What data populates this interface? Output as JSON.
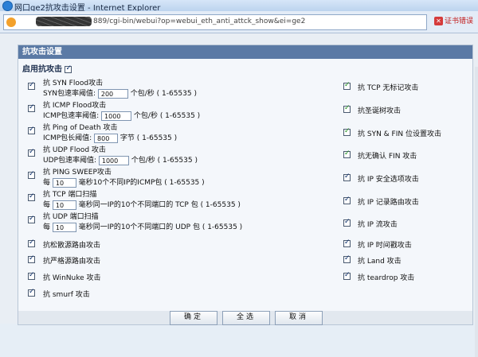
{
  "window": {
    "title": "网口ge2抗攻击设置 - Internet Explorer"
  },
  "address": {
    "url": "http://192.168.1.1:8889/cgi-bin/webui?op=webui_eth_anti_attck_show&ei=ge2",
    "url_shown": "889/cgi-bin/webui?op=webui_eth_anti_attck_show&ei=ge2",
    "cert_error": "证书错误"
  },
  "panel": {
    "title": "抗攻击设置",
    "enable_label": "启用抗攻击"
  },
  "left": [
    {
      "label": "抗 SYN Flood攻击",
      "sub_prefix": "SYN包速率阈值:",
      "value": "200",
      "sub_suffix": "个包/秒 ( 1-65535 )"
    },
    {
      "label": "抗 ICMP Flood攻击",
      "sub_prefix": "ICMP包速率阈值:",
      "value": "1000",
      "sub_suffix": "个包/秒 ( 1-65535 )"
    },
    {
      "label": "抗 Ping of Death 攻击",
      "sub_prefix": "ICMP包长阈值:",
      "value": "800",
      "sub_suffix": "字节 ( 1-65535 )"
    },
    {
      "label": "抗 UDP Flood 攻击",
      "sub_prefix": "UDP包速率阈值:",
      "value": "1000",
      "sub_suffix": "个包/秒 ( 1-65535 )"
    },
    {
      "label": "抗 PING SWEEP攻击",
      "sub_prefix": "每",
      "value": "10",
      "sub_suffix": "毫秒10个不同IP的ICMP包 ( 1-65535 )"
    },
    {
      "label": "抗 TCP 端口扫描",
      "sub_prefix": "每",
      "value": "10",
      "sub_suffix": "毫秒同一IP的10个不同端口的 TCP 包 ( 1-65535 )"
    },
    {
      "label": "抗 UDP 端口扫描",
      "sub_prefix": "每",
      "value": "10",
      "sub_suffix": "毫秒同一IP的10个不同端口的 UDP 包 ( 1-65535 )"
    },
    {
      "label": "抗松散源路由攻击"
    },
    {
      "label": "抗严格源路由攻击"
    },
    {
      "label": "抗 WinNuke 攻击"
    },
    {
      "label": "抗 smurf 攻击"
    }
  ],
  "right": [
    {
      "label": "抗 TCP 无标记攻击"
    },
    {
      "label": "抗圣诞树攻击"
    },
    {
      "label": "抗 SYN & FIN 位设置攻击"
    },
    {
      "label": "抗无确认 FIN 攻击"
    },
    {
      "label": "抗 IP 安全选项攻击"
    },
    {
      "label": "抗 IP 记录路由攻击"
    },
    {
      "label": "抗 IP 流攻击"
    },
    {
      "label": "抗 IP 时间戳攻击"
    },
    {
      "label": "抗 Land 攻击"
    },
    {
      "label": "抗 teardrop 攻击"
    }
  ],
  "buttons": {
    "ok": "确定",
    "select_all": "全选",
    "cancel": "取消"
  }
}
